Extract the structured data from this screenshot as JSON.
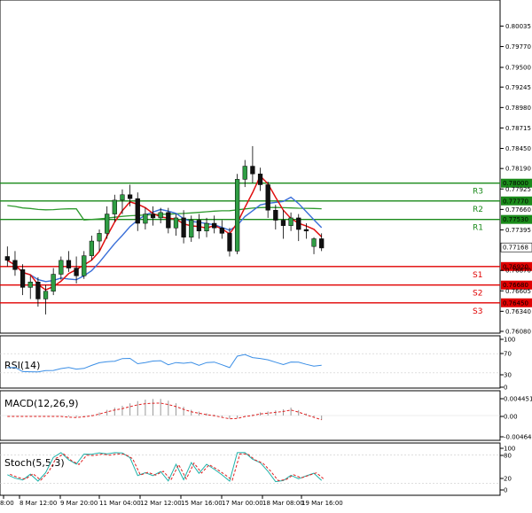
{
  "chart_data": {
    "type": "candlestick",
    "price_axis": {
      "ticks": [
        "0.80035",
        "0.79770",
        "0.79500",
        "0.79245",
        "0.78980",
        "0.78715",
        "0.78450",
        "0.78190",
        "0.77925",
        "0.77660",
        "0.77395",
        "0.76870",
        "0.76605",
        "0.76340",
        "0.76080"
      ],
      "current_price": "0.77168",
      "ylim": [
        0.7608,
        0.8035
      ]
    },
    "time_axis": {
      "ticks": [
        "8:00",
        "8 Mar 12:00",
        "9 Mar 20:00",
        "11 Mar 04:00",
        "12 Mar 12:00",
        "15 Mar 16:00",
        "17 Mar 00:00",
        "18 Mar 08:00",
        "19 Mar 16:00"
      ]
    },
    "levels": [
      {
        "name": "R3",
        "value": 0.78,
        "label": "0.78000",
        "color": "#1a8a1a"
      },
      {
        "name": "R2",
        "value": 0.7777,
        "label": "0.77770",
        "color": "#1a8a1a"
      },
      {
        "name": "R1",
        "value": 0.7753,
        "label": "0.77530",
        "color": "#1a8a1a"
      },
      {
        "name": "S1",
        "value": 0.7692,
        "label": "0.76920",
        "color": "#e00000"
      },
      {
        "name": "S2",
        "value": 0.7668,
        "label": "0.76680",
        "color": "#e00000"
      },
      {
        "name": "S3",
        "value": 0.7645,
        "label": "0.76450",
        "color": "#e00000"
      }
    ],
    "candles": [
      [
        0.7705,
        0.7718,
        0.7692,
        0.77
      ],
      [
        0.77,
        0.7712,
        0.768,
        0.7688
      ],
      [
        0.7688,
        0.7695,
        0.7655,
        0.7665
      ],
      [
        0.7665,
        0.768,
        0.765,
        0.7672
      ],
      [
        0.7672,
        0.7678,
        0.764,
        0.765
      ],
      [
        0.765,
        0.7668,
        0.763,
        0.766
      ],
      [
        0.766,
        0.769,
        0.7655,
        0.7682
      ],
      [
        0.7682,
        0.7705,
        0.7675,
        0.77
      ],
      [
        0.77,
        0.7712,
        0.7685,
        0.769
      ],
      [
        0.769,
        0.7705,
        0.767,
        0.768
      ],
      [
        0.768,
        0.7712,
        0.7676,
        0.7706
      ],
      [
        0.7706,
        0.7732,
        0.77,
        0.7725
      ],
      [
        0.7725,
        0.774,
        0.7712,
        0.7735
      ],
      [
        0.7735,
        0.777,
        0.7728,
        0.776
      ],
      [
        0.776,
        0.7785,
        0.775,
        0.7778
      ],
      [
        0.7778,
        0.7792,
        0.776,
        0.7785
      ],
      [
        0.7785,
        0.7798,
        0.777,
        0.778
      ],
      [
        0.778,
        0.7788,
        0.7738,
        0.7748
      ],
      [
        0.7748,
        0.7768,
        0.774,
        0.776
      ],
      [
        0.776,
        0.777,
        0.7745,
        0.7755
      ],
      [
        0.7755,
        0.7768,
        0.7748,
        0.7762
      ],
      [
        0.7762,
        0.7768,
        0.7735,
        0.7742
      ],
      [
        0.7742,
        0.776,
        0.7732,
        0.7755
      ],
      [
        0.7755,
        0.7765,
        0.7722,
        0.773
      ],
      [
        0.773,
        0.7758,
        0.7724,
        0.7752
      ],
      [
        0.7752,
        0.776,
        0.7728,
        0.7738
      ],
      [
        0.7738,
        0.7755,
        0.773,
        0.7748
      ],
      [
        0.7748,
        0.7758,
        0.7735,
        0.7742
      ],
      [
        0.7742,
        0.7752,
        0.7728,
        0.7735
      ],
      [
        0.7735,
        0.7742,
        0.7705,
        0.7712
      ],
      [
        0.7712,
        0.7812,
        0.7708,
        0.7805
      ],
      [
        0.7805,
        0.783,
        0.7795,
        0.7822
      ],
      [
        0.7822,
        0.7848,
        0.78,
        0.7812
      ],
      [
        0.7812,
        0.782,
        0.779,
        0.7798
      ],
      [
        0.7798,
        0.7802,
        0.7755,
        0.7765
      ],
      [
        0.7765,
        0.7772,
        0.774,
        0.7752
      ],
      [
        0.7752,
        0.7765,
        0.7728,
        0.7745
      ],
      [
        0.7745,
        0.7762,
        0.7738,
        0.7755
      ],
      [
        0.7755,
        0.776,
        0.7725,
        0.774
      ],
      [
        0.774,
        0.7748,
        0.7728,
        0.7738
      ],
      [
        0.7718,
        0.773,
        0.7708,
        0.7728
      ],
      [
        0.7728,
        0.7735,
        0.7712,
        0.7716
      ]
    ],
    "indicators": [
      {
        "name": "RSI(14)",
        "ticks": [
          "100",
          "70",
          "30",
          "0"
        ]
      },
      {
        "name": "MACD(12,26,9)",
        "ticks": [
          "0.004451",
          "0.00",
          "-0.004645"
        ]
      },
      {
        "name": "Stoch(5,5,3)",
        "ticks": [
          "100",
          "80",
          "20",
          "0"
        ]
      }
    ]
  }
}
